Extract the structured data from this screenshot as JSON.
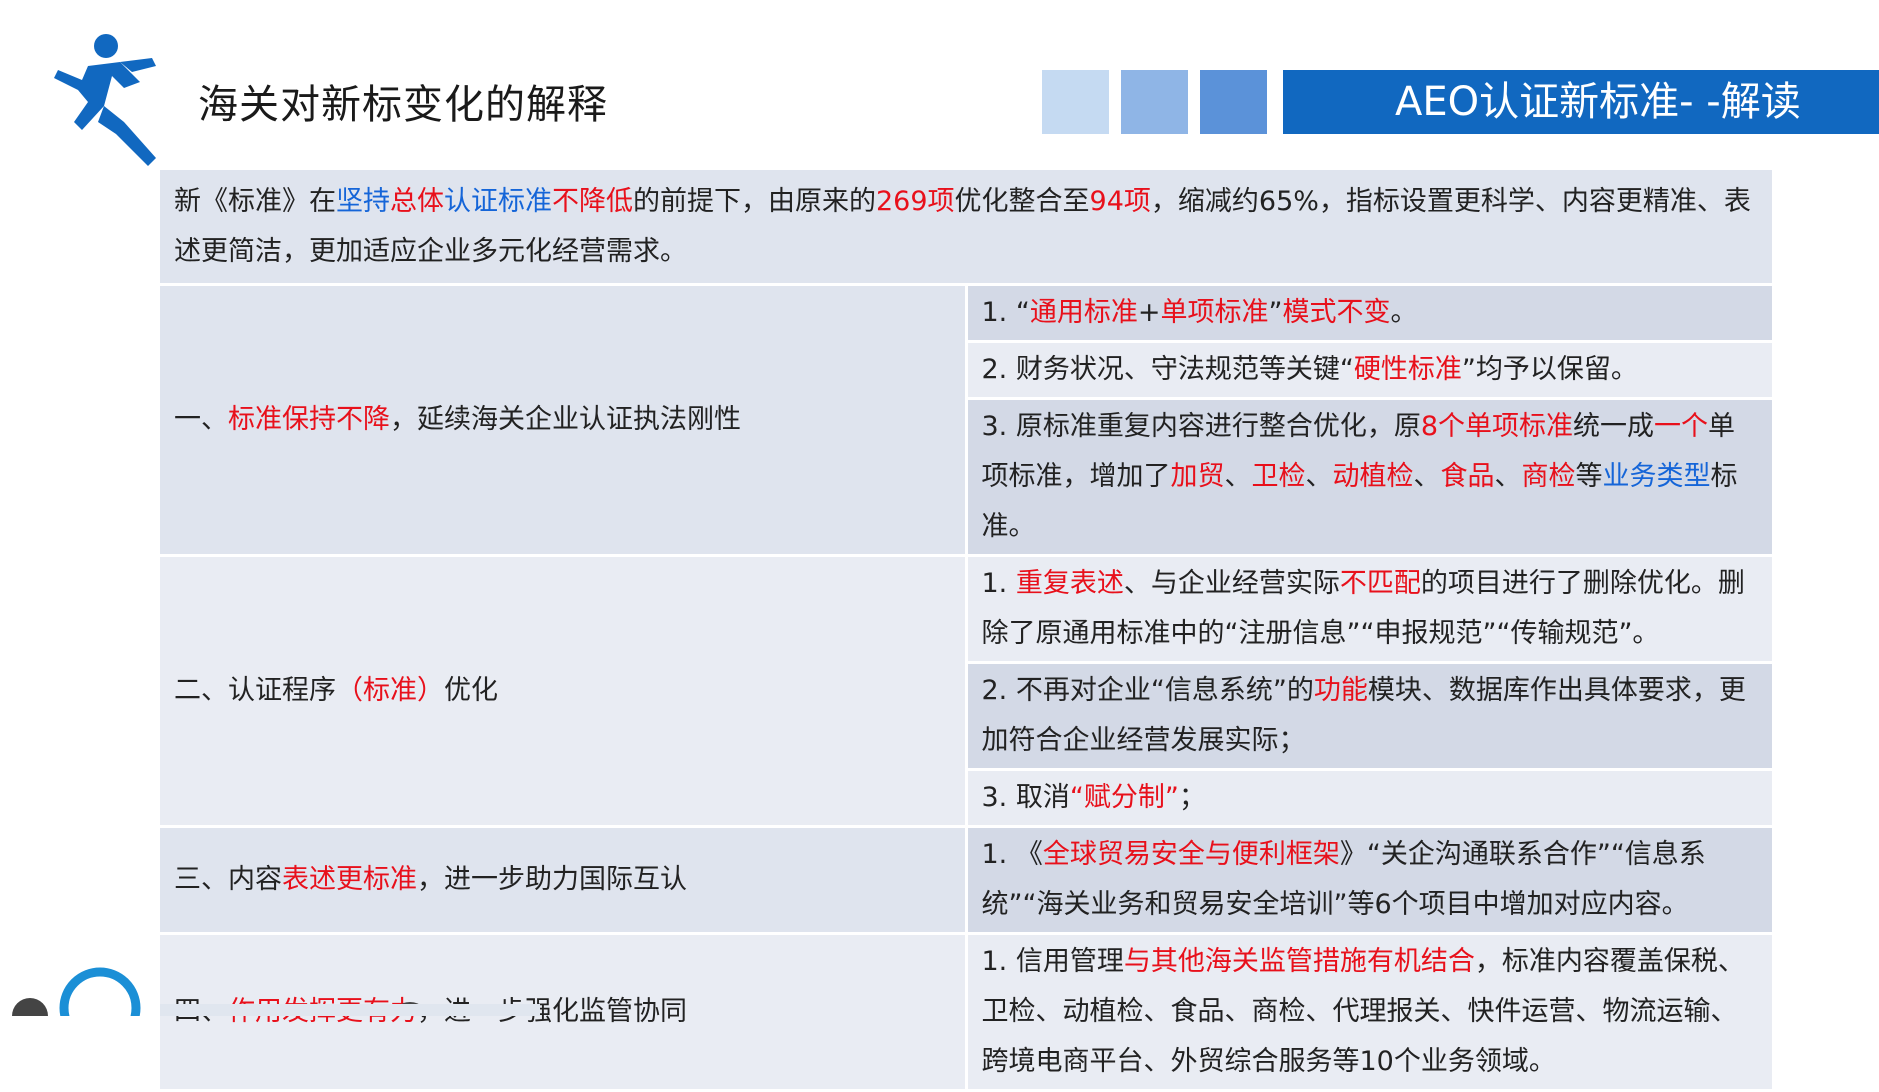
{
  "header": {
    "title": "海关对新标变化的解释",
    "banner_text": "AEO认证新标准- -解读",
    "square_colors": [
      "#c5daf2",
      "#8fb5e6",
      "#5b92d9"
    ],
    "banner_color": "#1168c0"
  },
  "logo": {
    "icon": "running-man-icon",
    "color": "#1168c0"
  },
  "intro": [
    {
      "t": "新《标准》在",
      "c": "k"
    },
    {
      "t": "坚持",
      "c": "b"
    },
    {
      "t": "总体",
      "c": "r"
    },
    {
      "t": "认证标准",
      "c": "b"
    },
    {
      "t": "不降低",
      "c": "r"
    },
    {
      "t": "的前提下，由原来的",
      "c": "k"
    },
    {
      "t": "269项",
      "c": "r"
    },
    {
      "t": "优化整合至",
      "c": "k"
    },
    {
      "t": "94项",
      "c": "r"
    },
    {
      "t": "，缩减约65%，指标设置更科学、内容更精准、表述更简洁，更加适应企业多元化经营需求。",
      "c": "k"
    }
  ],
  "sections": [
    {
      "category": [
        {
          "t": "一、",
          "c": "k"
        },
        {
          "t": "标准保持不降",
          "c": "r"
        },
        {
          "t": "，延续海关企业认证执法刚性",
          "c": "k"
        }
      ],
      "items": [
        [
          {
            "t": "1. “",
            "c": "k"
          },
          {
            "t": "通用标准",
            "c": "r"
          },
          {
            "t": "+",
            "c": "k"
          },
          {
            "t": "单项标准",
            "c": "r"
          },
          {
            "t": "”",
            "c": "k"
          },
          {
            "t": "模式不变",
            "c": "r"
          },
          {
            "t": "。",
            "c": "k"
          }
        ],
        [
          {
            "t": "2. 财务状况、守法规范等关键“",
            "c": "k"
          },
          {
            "t": "硬性标准",
            "c": "r"
          },
          {
            "t": "”均予以保留。",
            "c": "k"
          }
        ],
        [
          {
            "t": "3. 原标准重复内容进行整合优化，原",
            "c": "k"
          },
          {
            "t": "8个单项标准",
            "c": "r"
          },
          {
            "t": "统一成",
            "c": "k"
          },
          {
            "t": "一个",
            "c": "r"
          },
          {
            "t": "单项标准，增加了",
            "c": "k"
          },
          {
            "t": "加贸",
            "c": "r"
          },
          {
            "t": "、",
            "c": "k"
          },
          {
            "t": "卫检",
            "c": "r"
          },
          {
            "t": "、",
            "c": "k"
          },
          {
            "t": "动植检",
            "c": "r"
          },
          {
            "t": "、",
            "c": "k"
          },
          {
            "t": "食品",
            "c": "r"
          },
          {
            "t": "、",
            "c": "k"
          },
          {
            "t": "商检",
            "c": "r"
          },
          {
            "t": "等",
            "c": "k"
          },
          {
            "t": "业务类型",
            "c": "b"
          },
          {
            "t": "标准。",
            "c": "k"
          }
        ]
      ]
    },
    {
      "category": [
        {
          "t": "二、认证程序",
          "c": "k"
        },
        {
          "t": "（标准）",
          "c": "r"
        },
        {
          "t": "优化",
          "c": "k"
        }
      ],
      "items": [
        [
          {
            "t": "1. ",
            "c": "k"
          },
          {
            "t": "重复表述",
            "c": "r"
          },
          {
            "t": "、与企业经营实际",
            "c": "k"
          },
          {
            "t": "不匹配",
            "c": "r"
          },
          {
            "t": "的项目进行了删除优化。删除了原通用标准中的“注册信息”“申报规范”“传输规范”。",
            "c": "k"
          }
        ],
        [
          {
            "t": "2. 不再对企业“信息系统”的",
            "c": "k"
          },
          {
            "t": "功能",
            "c": "r"
          },
          {
            "t": "模块、数据库作出具体要求，更加符合企业经营发展实际；",
            "c": "k"
          }
        ],
        [
          {
            "t": "3. 取消",
            "c": "k"
          },
          {
            "t": "“赋分制”",
            "c": "r"
          },
          {
            "t": "；",
            "c": "k"
          }
        ]
      ]
    },
    {
      "category": [
        {
          "t": "三、内容",
          "c": "k"
        },
        {
          "t": "表述更标准",
          "c": "r"
        },
        {
          "t": "，进一步助力国际互认",
          "c": "k"
        }
      ],
      "items": [
        [
          {
            "t": "1. 《",
            "c": "k"
          },
          {
            "t": "全球贸易安全与便利框架",
            "c": "r"
          },
          {
            "t": "》“关企沟通联系合作”“信息系统”“海关业务和贸易安全培训”等6个项目中增加对应内容。",
            "c": "k"
          }
        ]
      ]
    },
    {
      "category": [
        {
          "t": "四、",
          "c": "k"
        },
        {
          "t": "作用发挥更有力",
          "c": "r"
        },
        {
          "t": "，进一步强化监管协同",
          "c": "k"
        }
      ],
      "items": [
        [
          {
            "t": "1. 信用管理",
            "c": "k"
          },
          {
            "t": "与其他海关监管措施有机结合",
            "c": "r"
          },
          {
            "t": "，标准内容覆盖保税、卫检、动植检、食品、商检、代理报关、快件运营、物流运输、跨境电商平台、外贸综合服务等10个业务领域。",
            "c": "k"
          }
        ]
      ]
    }
  ]
}
